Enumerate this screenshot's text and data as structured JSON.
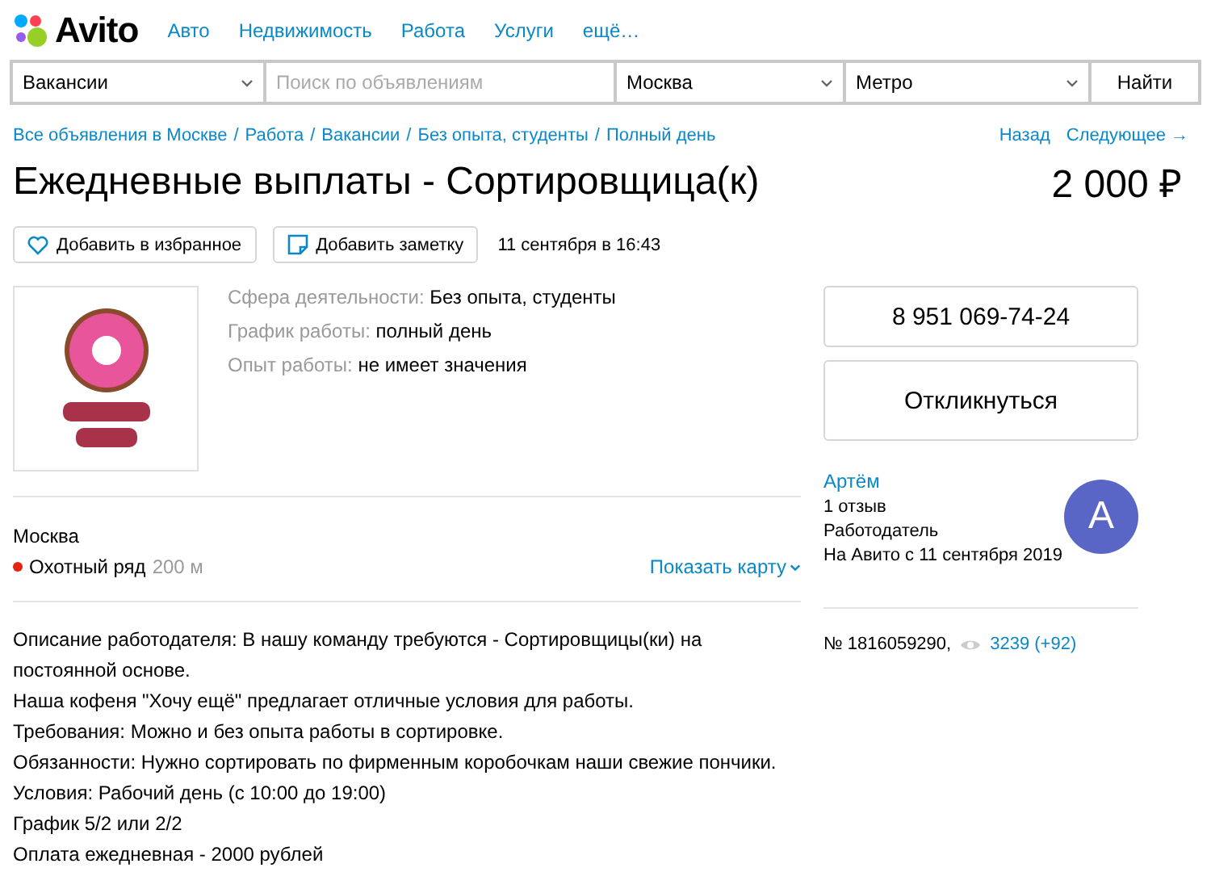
{
  "header": {
    "logo": "Avito",
    "nav": [
      "Авто",
      "Недвижимость",
      "Работа",
      "Услуги",
      "ещё…"
    ]
  },
  "search": {
    "category": "Вакансии",
    "placeholder": "Поиск по объявлениям",
    "city": "Москва",
    "metro": "Метро",
    "button": "Найти"
  },
  "breadcrumb_separator": "/",
  "breadcrumbs": [
    "Все объявления в Москве",
    "Работа",
    "Вакансии",
    "Без опыта, студенты",
    "Полный день"
  ],
  "pager": {
    "back": "Назад",
    "next": "Следующее →"
  },
  "title": "Ежедневные выплаты - Сортировщица(к)",
  "price": "2 000 ₽",
  "actions": {
    "favorite": "Добавить в избранное",
    "note": "Добавить заметку",
    "date": "11 сентября в 16:43"
  },
  "params": [
    {
      "label": "Сфера деятельности:",
      "value": "Без опыта, студенты"
    },
    {
      "label": "График работы:",
      "value": "полный день"
    },
    {
      "label": "Опыт работы:",
      "value": "не имеет значения"
    }
  ],
  "location": {
    "city": "Москва",
    "metro": "Охотный ряд",
    "distance": "200 м",
    "map_link": "Показать карту"
  },
  "description": [
    "Описание работодателя: В нашу команду требуются - Сортировщицы(ки) на постоянной основе.",
    "Наша кофеня \"Хочу ещё\" предлагает отличные условия для работы.",
    "Требования: Можно и без опыта работы в сортировке.",
    "Обязанности: Нужно сортировать по фирменным коробочкам наши свежие пончики.",
    "Условия: Рабочий день (с 10:00 до 19:00)",
    "График 5/2 или 2/2",
    "Оплата ежедневная - 2000 рублей"
  ],
  "contact": {
    "phone": "8 951 069-74-24",
    "respond": "Откликнуться"
  },
  "seller": {
    "name": "Артём",
    "reviews": "1 отзыв",
    "type": "Работодатель",
    "since": "На Авито с 11 сентября 2019",
    "avatar_letter": "А"
  },
  "stats": {
    "number": "№ 1816059290,",
    "views": "3239 (+92)"
  }
}
